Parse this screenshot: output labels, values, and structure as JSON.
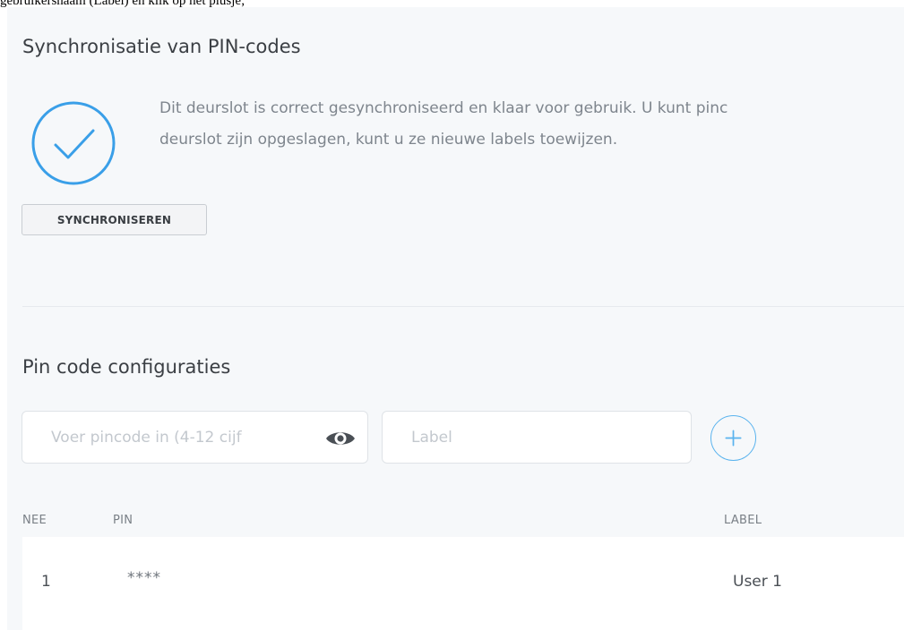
{
  "caption": "gebruikersnaam (Label) en klik op het plusje;",
  "sync": {
    "title": "Synchronisatie van PIN-codes",
    "description_line1": "Dit deurslot is correct gesynchroniseerd en klaar voor gebruik. U kunt pinc",
    "description_line2": "deurslot zijn opgeslagen, kunt u ze nieuwe labels toewijzen.",
    "button_label": "SYNCHRONISEREN",
    "status_icon": "check-circle-icon",
    "accent_color": "#3a9fe8"
  },
  "pin_config": {
    "title": "Pin code configuraties",
    "pin_input_placeholder": "Voer pincode in (4-12 cijf",
    "pin_input_value": "",
    "label_input_placeholder": "Label",
    "label_input_value": "",
    "visibility_icon": "eye-icon",
    "add_icon": "plus-circle-icon",
    "columns": [
      "NEE",
      "PIN",
      "LABEL"
    ],
    "rows": [
      {
        "nee": "1",
        "pin": "****",
        "label": "User 1"
      }
    ]
  }
}
